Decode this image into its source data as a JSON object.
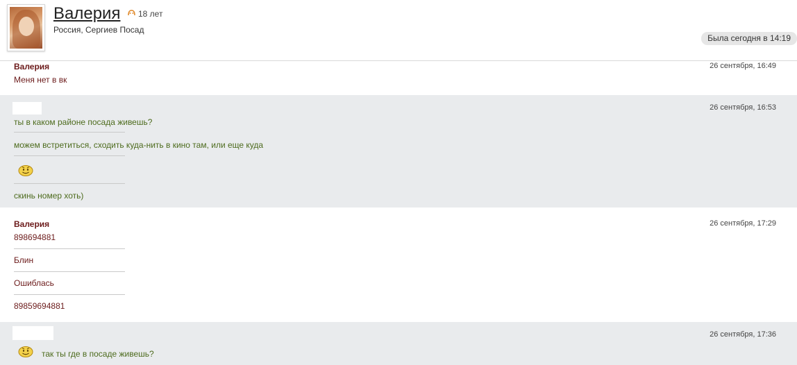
{
  "profile": {
    "name": "Валерия",
    "age": "18 лет",
    "location": "Россия, Сергиев Посад",
    "status": "Была сегодня в 14:19"
  },
  "messages": [
    {
      "sender": "Валерия",
      "time": "26 сентября, 16:49",
      "lines": [
        "Меня нет в вк"
      ]
    },
    {
      "sender": "",
      "time": "26 сентября, 16:53",
      "lines": [
        "ты в каком районе посада живешь?",
        "можем встретиться, сходить куда-нить в кино там, или еще куда",
        "скинь номер хоть)"
      ]
    },
    {
      "sender": "Валерия",
      "time": "26 сентября, 17:29",
      "lines": [
        "898694881",
        "Блин",
        "Ошиблась",
        "89859694881"
      ]
    },
    {
      "sender": "",
      "time": "26 сентября, 17:36",
      "lines": [
        "так ты где в посаде живешь?"
      ]
    }
  ],
  "icons": {
    "age": "zodiac-icon",
    "emoticon": "smiley-icon"
  },
  "colors": {
    "her_text": "#6b1a1a",
    "his_text": "#4d6b1d",
    "grey_bg": "#e9ebed"
  }
}
